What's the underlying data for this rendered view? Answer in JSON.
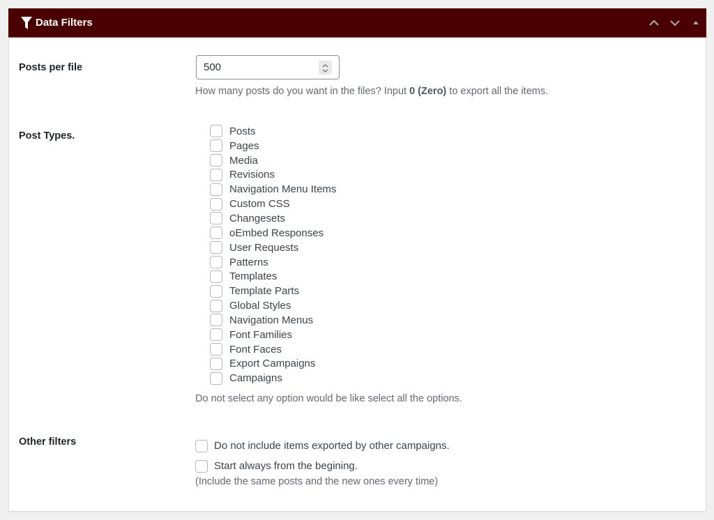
{
  "panel": {
    "title": "Data Filters",
    "title_icon": "funnel-icon",
    "header_color": "#4a0000",
    "controls": [
      {
        "name": "move-up",
        "icon": "chevron-up-icon"
      },
      {
        "name": "move-down",
        "icon": "chevron-down-icon"
      },
      {
        "name": "toggle-panel",
        "icon": "triangle-up-icon"
      }
    ]
  },
  "posts_per_file": {
    "label": "Posts per file",
    "value": "500",
    "description_before": "How many posts do you want in the files? Input ",
    "description_bold": "0 (Zero)",
    "description_after": " to export all the items."
  },
  "post_types": {
    "label": "Post Types.",
    "options": [
      {
        "label": "Posts",
        "checked": false
      },
      {
        "label": "Pages",
        "checked": false
      },
      {
        "label": "Media",
        "checked": false
      },
      {
        "label": "Revisions",
        "checked": false
      },
      {
        "label": "Navigation Menu Items",
        "checked": false
      },
      {
        "label": "Custom CSS",
        "checked": false
      },
      {
        "label": "Changesets",
        "checked": false
      },
      {
        "label": "oEmbed Responses",
        "checked": false
      },
      {
        "label": "User Requests",
        "checked": false
      },
      {
        "label": "Patterns",
        "checked": false
      },
      {
        "label": "Templates",
        "checked": false
      },
      {
        "label": "Template Parts",
        "checked": false
      },
      {
        "label": "Global Styles",
        "checked": false
      },
      {
        "label": "Navigation Menus",
        "checked": false
      },
      {
        "label": "Font Families",
        "checked": false
      },
      {
        "label": "Font Faces",
        "checked": false
      },
      {
        "label": "Export Campaigns",
        "checked": false
      },
      {
        "label": "Campaigns",
        "checked": false
      }
    ],
    "description": "Do not select any option would be like select all the options."
  },
  "other_filters": {
    "label": "Other filters",
    "options": [
      {
        "label": "Do not include items exported by other campaigns.",
        "checked": false
      },
      {
        "label": "Start always from the begining.",
        "checked": false
      }
    ],
    "description": "(Include the same posts and the new ones every time)"
  }
}
